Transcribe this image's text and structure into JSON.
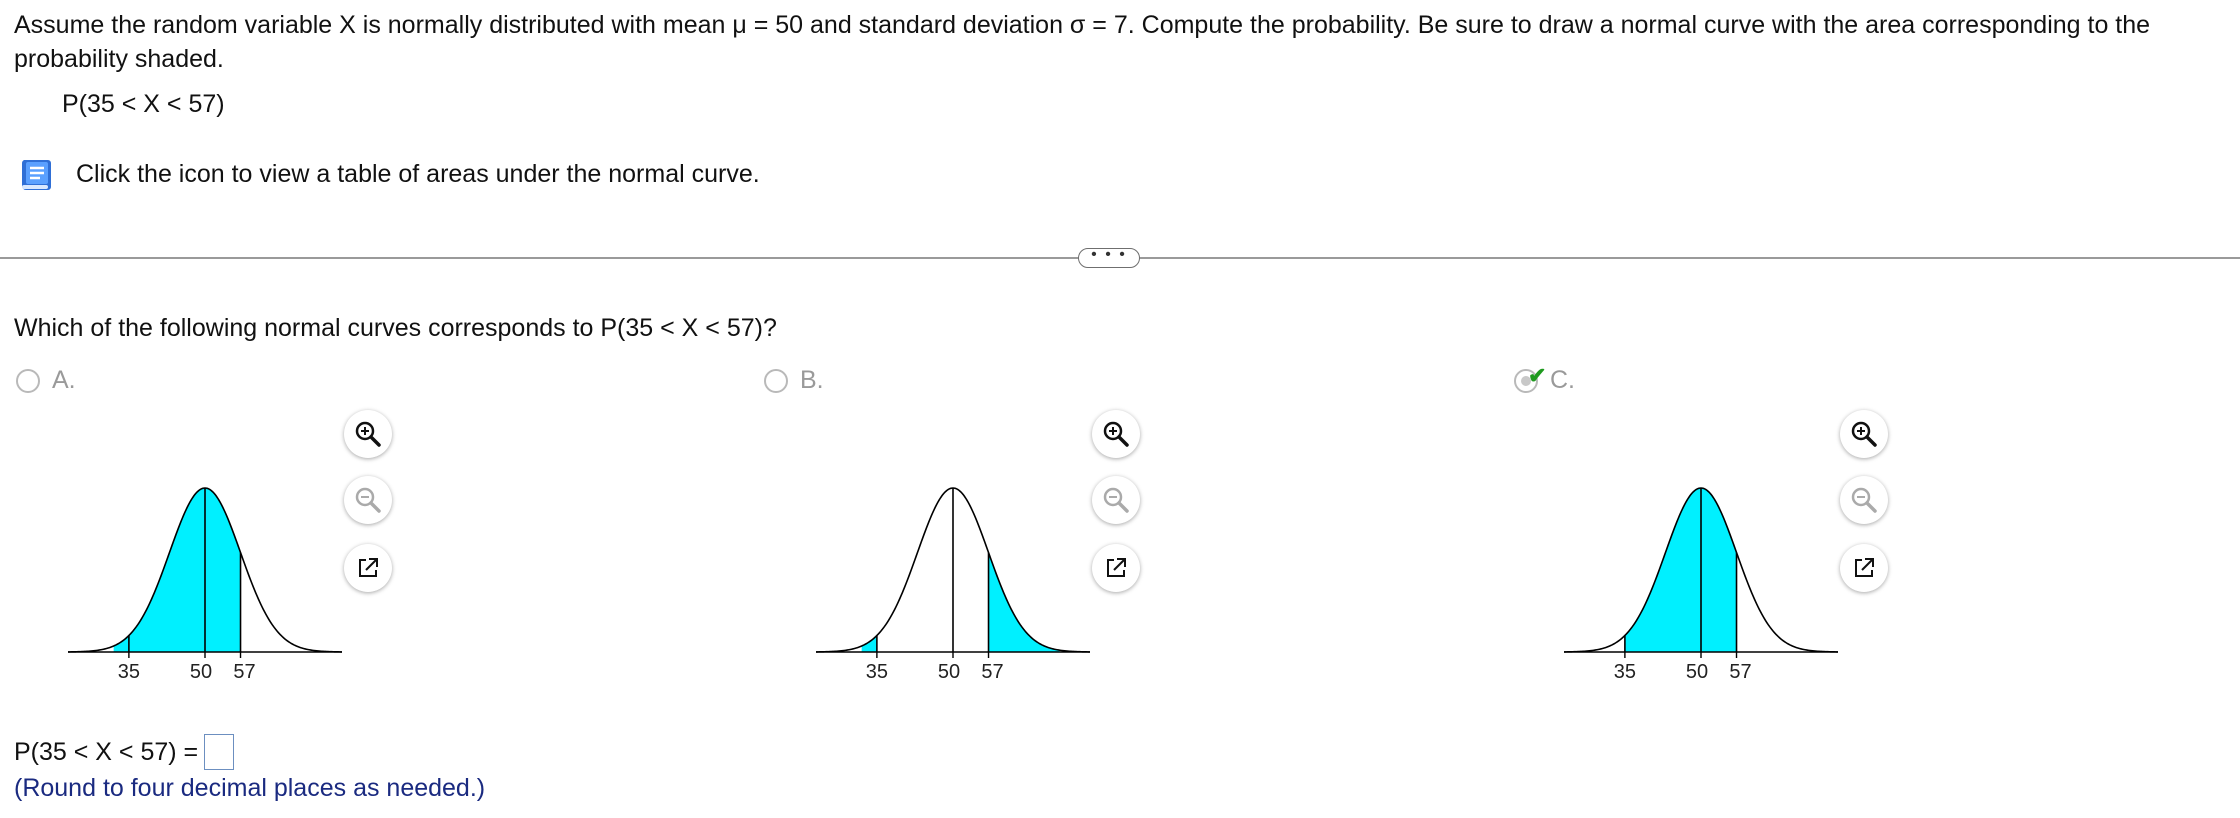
{
  "question": {
    "text": "Assume the random variable X is normally distributed with mean μ = 50 and standard deviation σ = 7. Compute the probability. Be sure to draw a normal curve with the area corresponding to the probability shaded.",
    "expression": "P(35 < X < 57)",
    "table_hint": "Click the icon to view a table of areas under the normal curve."
  },
  "more_button": "• • •",
  "subquestion": "Which of the following normal curves corresponds to P(35 < X < 57)?",
  "choices": [
    {
      "letter": "A.",
      "selected": false,
      "ticks": [
        "35",
        "50",
        "57"
      ]
    },
    {
      "letter": "B.",
      "selected": false,
      "ticks": [
        "35",
        "50",
        "57"
      ]
    },
    {
      "letter": "C.",
      "selected": true,
      "ticks": [
        "35",
        "50",
        "57"
      ]
    }
  ],
  "answer": {
    "label": "P(35 < X < 57) =",
    "value": "",
    "note": "(Round to four decimal places as needed.)"
  },
  "chart_data": [
    {
      "type": "area",
      "mean": 50,
      "sd": 7,
      "x_ticks": [
        35,
        50,
        57
      ],
      "shaded_regions": [
        [
          32,
          57
        ]
      ]
    },
    {
      "type": "area",
      "mean": 50,
      "sd": 7,
      "x_ticks": [
        35,
        50,
        57
      ],
      "shaded_regions": [
        [
          32,
          35
        ],
        [
          57,
          71
        ]
      ]
    },
    {
      "type": "area",
      "mean": 50,
      "sd": 7,
      "x_ticks": [
        35,
        50,
        57
      ],
      "shaded_regions": [
        [
          35,
          57
        ]
      ]
    }
  ],
  "colors": {
    "shade": "#00f0ff",
    "curve": "#000000",
    "answer_note": "#1a2a80"
  }
}
